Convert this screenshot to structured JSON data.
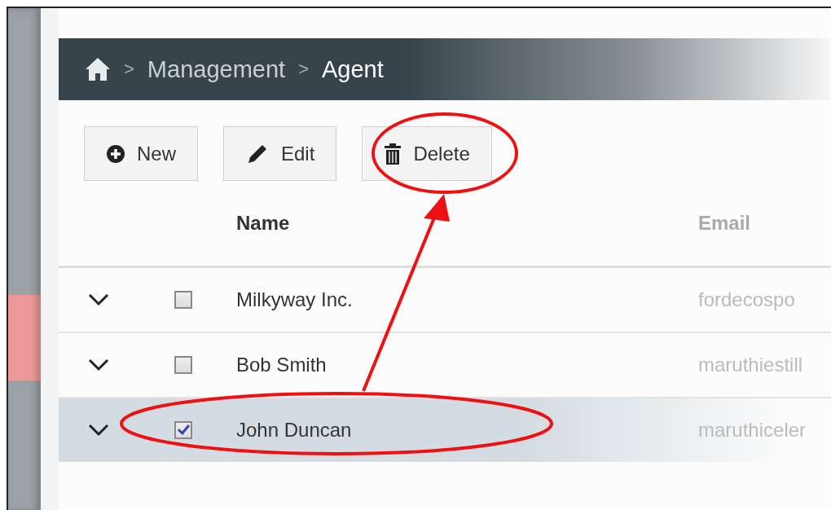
{
  "breadcrumb": [
    "Management",
    "Agent"
  ],
  "separator": ">",
  "toolbar": [
    {
      "kind": "new",
      "label": "New"
    },
    {
      "kind": "edit",
      "label": "Edit"
    },
    {
      "kind": "delete",
      "label": "Delete"
    }
  ],
  "table": {
    "columns": [
      "Name",
      "Email"
    ],
    "rows": [
      {
        "name": "Milkyway Inc.",
        "email": "fordecospo",
        "checked": false,
        "selected": false
      },
      {
        "name": "Bob Smith",
        "email": "maruthiestill",
        "checked": false,
        "selected": false
      },
      {
        "name": "John Duncan",
        "email": "maruthiceler",
        "checked": true,
        "selected": true
      }
    ]
  }
}
